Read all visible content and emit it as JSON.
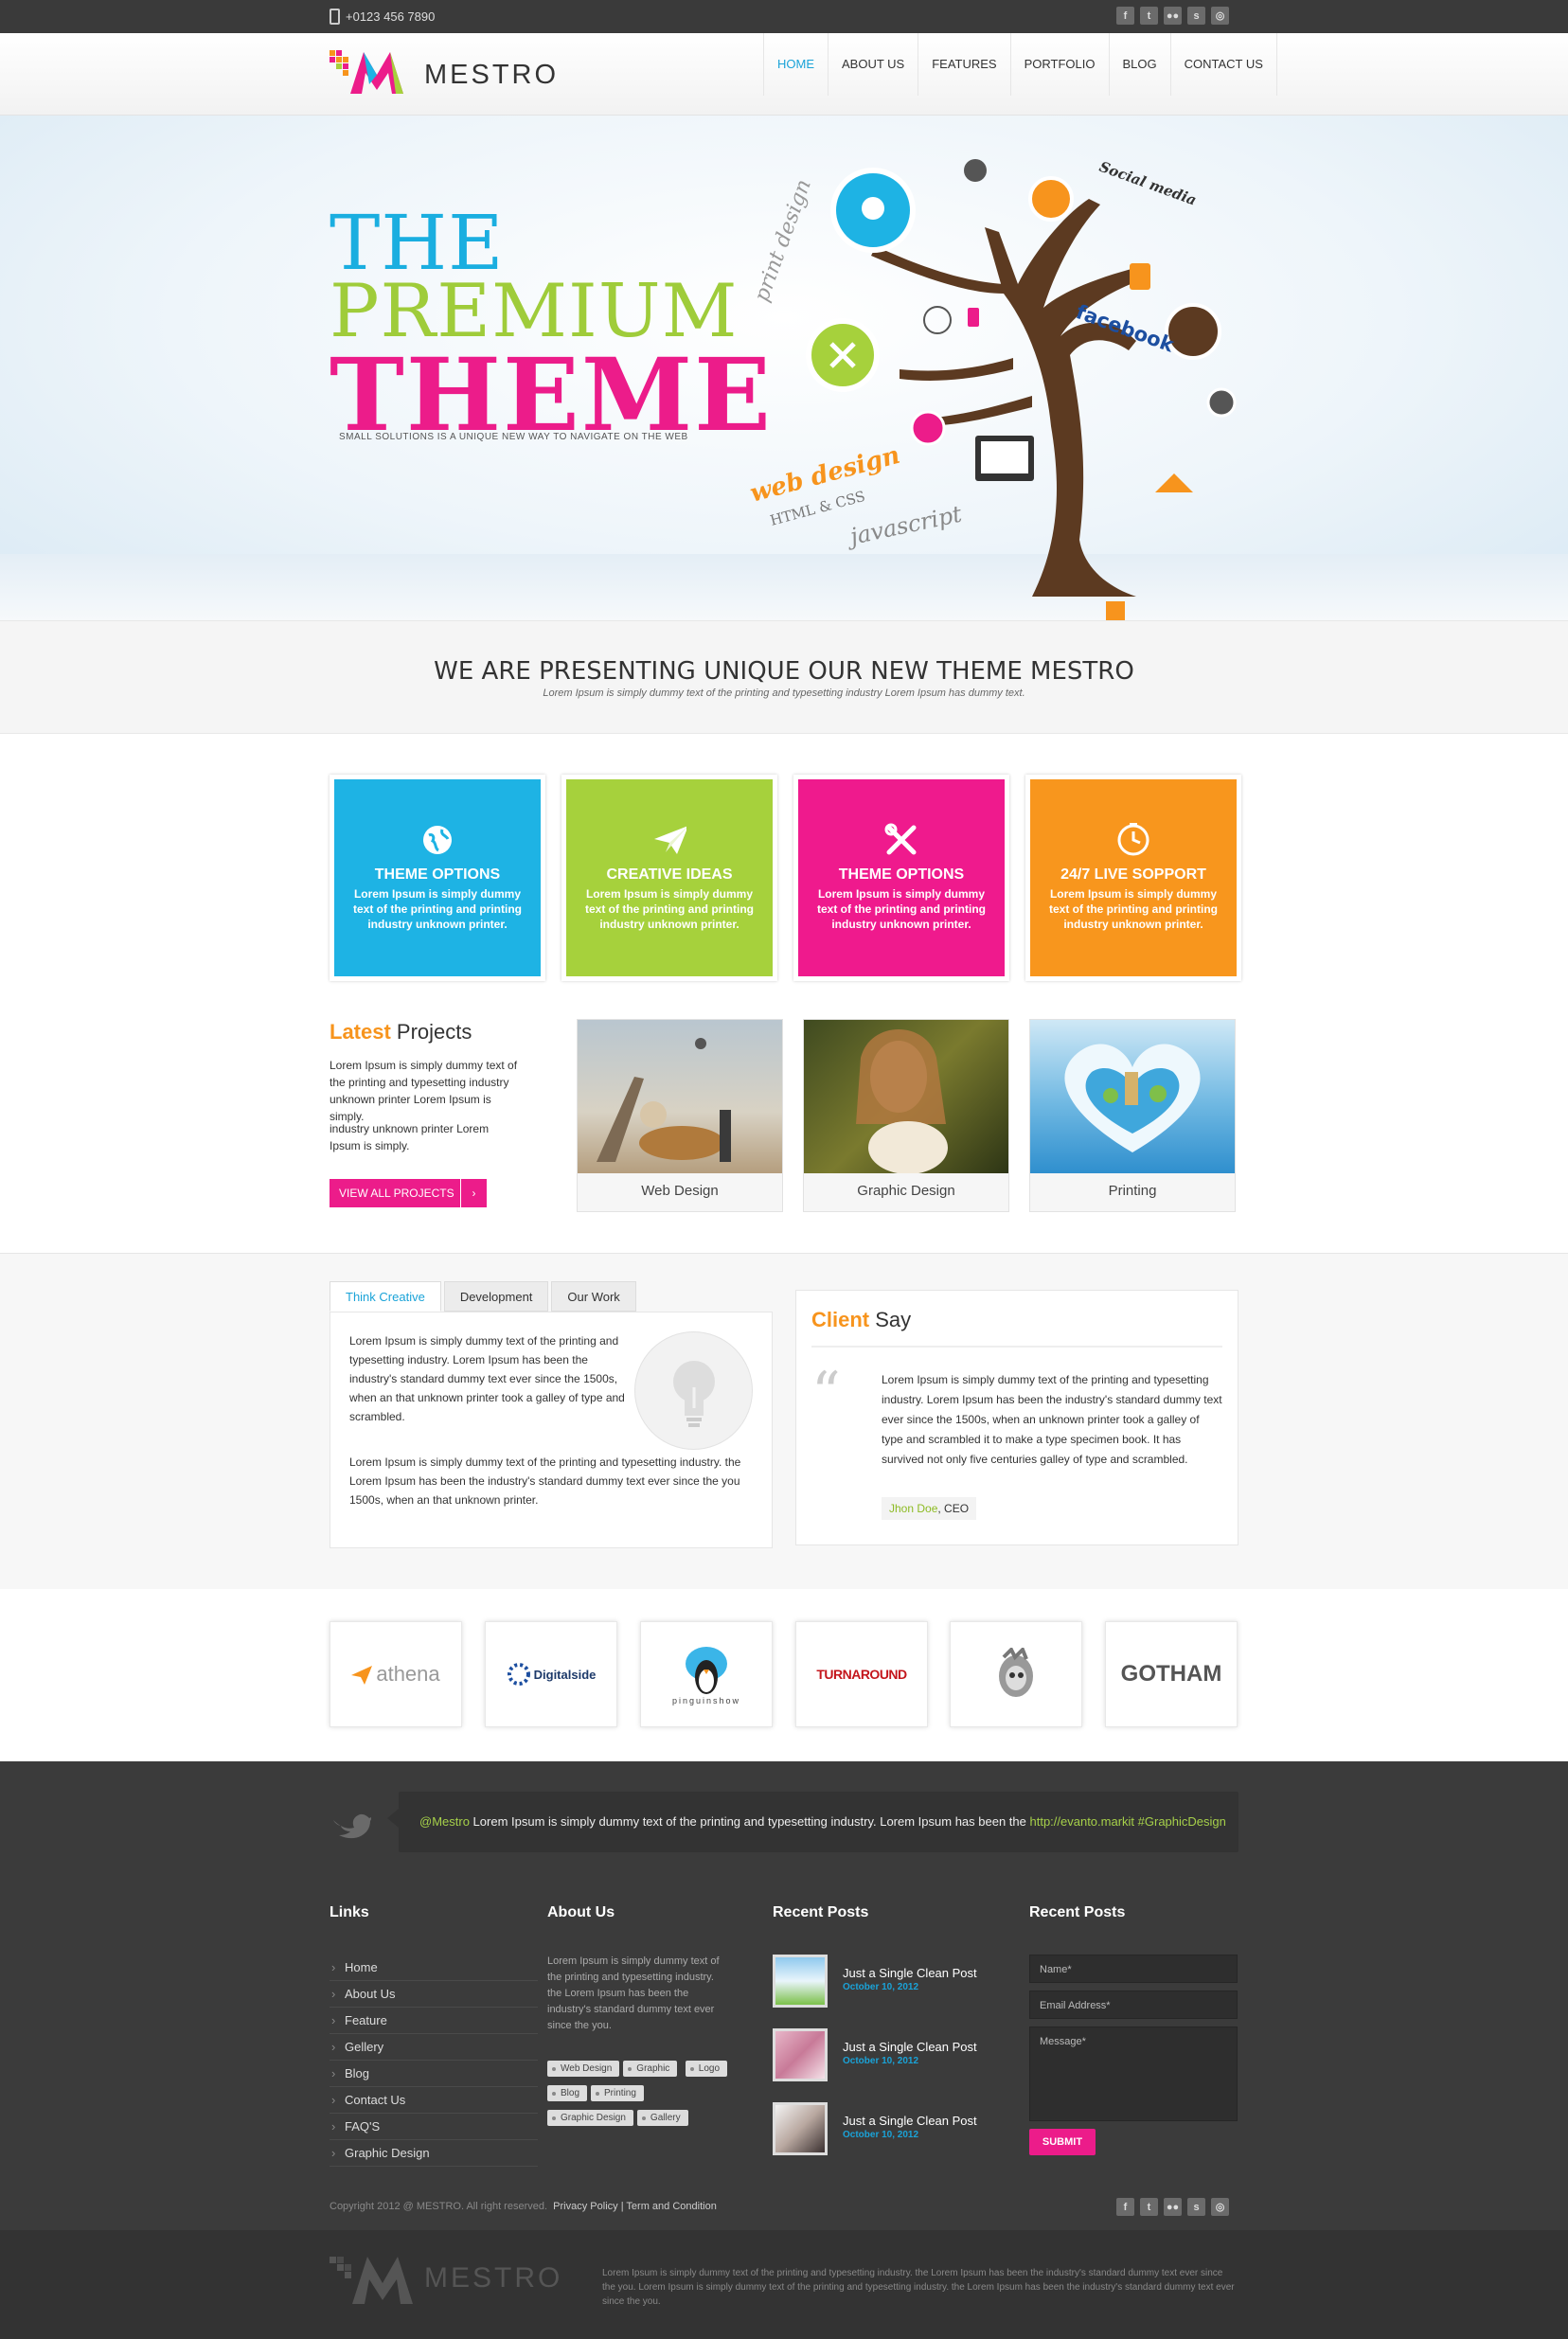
{
  "topbar": {
    "phone": "+0123 456 7890",
    "social": [
      "f",
      "t",
      "●●",
      "s",
      "◎"
    ],
    "social_names": [
      "facebook",
      "twitter",
      "flickr",
      "skype",
      "dribbble"
    ]
  },
  "header": {
    "logo": "MESTRO",
    "nav": [
      "HOME",
      "ABOUT US",
      "FEATURES",
      "PORTFOLIO",
      "BLOG",
      "CONTACT US"
    ],
    "active": "HOME"
  },
  "hero": {
    "line1": "THE",
    "line2": "PREMIUM",
    "line3": "THEME",
    "tagline": "SMALL SOLUTIONS IS A UNIQUE NEW WAY TO NAVIGATE ON THE WEB",
    "tree_words": {
      "print": "print design",
      "social": "Social media",
      "facebook": "facebook",
      "web": "web design",
      "html": "HTML & CSS",
      "js": "javascript",
      "html5": "HTML"
    }
  },
  "present": {
    "title": "WE ARE PRESENTING UNIQUE OUR NEW THEME MESTRO",
    "subtitle": "Lorem Ipsum is simply dummy text of the printing and typesetting industry Lorem Ipsum has dummy text."
  },
  "features": [
    {
      "title": "THEME OPTIONS",
      "text": "Lorem Ipsum is simply dummy text of the printing and printing industry unknown printer.",
      "color": "#1eb3e4",
      "icon": "globe-icon"
    },
    {
      "title": "CREATIVE IDEAS",
      "text": "Lorem Ipsum is simply dummy text of the printing and printing industry unknown printer.",
      "color": "#a6d13c",
      "icon": "paper-plane-icon"
    },
    {
      "title": "THEME OPTIONS",
      "text": "Lorem Ipsum is simply dummy text of the printing and printing industry unknown printer.",
      "color": "#ef1a8d",
      "icon": "tools-icon"
    },
    {
      "title": "24/7 LIVE SOPPORT",
      "text": "Lorem Ipsum is simply dummy text of the printing and printing industry unknown printer.",
      "color": "#f8961d",
      "icon": "clock-icon"
    }
  ],
  "latest": {
    "title_hl": "Latest",
    "title_rest": "Projects",
    "text1": "Lorem Ipsum is simply dummy text of the printing and typesetting industry unknown printer Lorem Ipsum is simply.",
    "text2": "industry unknown printer Lorem Ipsum is simply.",
    "button": "VIEW ALL PROJECTS",
    "projects": [
      "Web Design",
      "Graphic Design",
      "Printing"
    ]
  },
  "tabs": {
    "items": [
      "Think Creative",
      "Development",
      "Our Work"
    ],
    "para1": "Lorem Ipsum is simply dummy text of the printing and typesetting industry. Lorem Ipsum has been the industry's standard dummy text ever since the 1500s, when an that unknown printer took a galley of type and scrambled.",
    "para2": "Lorem Ipsum is simply dummy text of the printing and typesetting industry. the Lorem Ipsum has been the industry's standard dummy text ever since the you 1500s, when an that unknown printer."
  },
  "client": {
    "title_hl": "Client",
    "title_rest": "Say",
    "quote": "Lorem Ipsum is simply dummy text of the printing and typesetting industry. Lorem Ipsum has been the industry's standard dummy text ever since the 1500s, when an unknown printer took a galley of type and scrambled it to make a type specimen book. It has survived not only five centuries galley of type and scrambled.",
    "name": "Jhon Doe",
    "role": ", CEO"
  },
  "partners": [
    "athena",
    "Digitalside",
    "pinguinshow",
    "TURNAROUND",
    "",
    "GOTHAM"
  ],
  "tweet": {
    "handle": "@Mestro",
    "text": " Lorem Ipsum is simply dummy text of the printing and typesetting industry. Lorem Ipsum has been the ",
    "link": "http://evanto.markit #GraphicDesign"
  },
  "footer": {
    "links_title": "Links",
    "links": [
      "Home",
      "About Us",
      "Feature",
      "Gellery",
      "Blog",
      "Contact Us",
      "FAQ'S",
      "Graphic Design"
    ],
    "about_title": "About Us",
    "about_text": "Lorem Ipsum is simply dummy text of the printing and typesetting industry. the Lorem Ipsum has been the industry's standard dummy text ever since the you.",
    "tags": [
      "Web Design",
      "Graphic",
      "Logo",
      "Blog",
      "Printing",
      "Graphic Design",
      "Gallery"
    ],
    "posts_title": "Recent Posts",
    "posts": [
      {
        "title": "Just a Single Clean Post",
        "date": "October 10, 2012"
      },
      {
        "title": "Just a Single Clean Post",
        "date": "October 10, 2012"
      },
      {
        "title": "Just a Single Clean Post",
        "date": "October 10, 2012"
      }
    ],
    "form_title": "Recent Posts",
    "name_ph": "Name*",
    "email_ph": "Email Address*",
    "message_ph": "Message*",
    "submit": "SUBMIT",
    "copyright": "Copyright 2012 @ MESTRO. All right reserved.",
    "privacy": "Privacy Policy",
    "sep": " | ",
    "terms": "Term and Condition",
    "bottom_text": "Lorem Ipsum is simply dummy text of the printing and typesetting industry. the Lorem Ipsum has been the industry's standard dummy text ever since the you. Lorem Ipsum is simply dummy text of the printing and typesetting industry. the Lorem Ipsum has been the industry's standard dummy text ever since the you.",
    "bottom_logo": "MESTRO"
  }
}
